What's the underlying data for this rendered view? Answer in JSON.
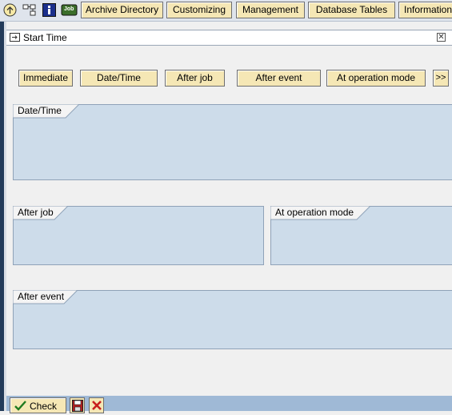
{
  "toolbar": {
    "icons": [
      "tree-icon",
      "hierarchy-icon",
      "info-icon",
      "job-icon"
    ],
    "job_icon_text": "Job",
    "buttons": [
      "Archive Directory",
      "Customizing",
      "Management",
      "Database Tables",
      "Information"
    ]
  },
  "dialog": {
    "title": "Start Time",
    "close_symbol": "✕",
    "options": [
      "Immediate",
      "Date/Time",
      "After job",
      "After event",
      "At operation mode",
      ">>"
    ],
    "groups": {
      "datetime": "Date/Time",
      "afterjob": "After job",
      "opmode": "At operation mode",
      "afterevent": "After event"
    }
  },
  "footer": {
    "check_label": "Check",
    "save_icon": "save-icon",
    "cancel_icon": "cancel-icon"
  },
  "colors": {
    "button_bg": "#f5e7b5",
    "group_bg": "#cddcea",
    "footer_bg": "#9fb9d6",
    "cancel_red": "#c81e1e"
  }
}
